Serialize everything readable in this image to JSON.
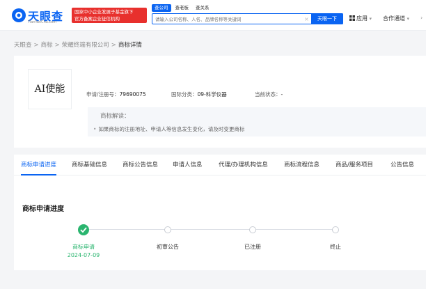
{
  "header": {
    "logo_text": "天眼查",
    "logo_sub": "TianYanCha.com",
    "promo_line1": "国家中小企业发展子基金旗下",
    "promo_line2": "官方备案企业征信机构",
    "search_tabs": [
      "查公司",
      "查老板",
      "查关系"
    ],
    "search_placeholder": "请输入公司名称、人名、品牌名称等关键词",
    "search_clear": "×",
    "search_button": "天眼一下",
    "nav_apps": "应用",
    "nav_coop": "合作通道",
    "nav_more": "›",
    "caret": "▾"
  },
  "breadcrumb": {
    "items": [
      "天眼查",
      "商标",
      "荣耀终端有限公司"
    ],
    "current": "商标详情",
    "separator": ">"
  },
  "trademark": {
    "name": "AI使能",
    "reg_no_label": "申请/注册号：",
    "reg_no": "79690075",
    "class_label": "国际分类：",
    "class_value": "09-科学仪器",
    "status_label": "当前状态：",
    "status_value": "-",
    "interp_title": "商标解读：",
    "interp_bullet": "如果商标的注册地址、申请人等信息发生变化，请及时变更商标",
    "bullet_dot": "•"
  },
  "tabs": [
    "商标申请进度",
    "商标基础信息",
    "商标公告信息",
    "申请人信息",
    "代理/办理机构信息",
    "商标流程信息",
    "商品/服务项目",
    "公告信息"
  ],
  "progress": {
    "title": "商标申请进度",
    "steps": [
      {
        "label": "商标申请",
        "date": "2024-07-09",
        "done": true
      },
      {
        "label": "初审公告",
        "date": "",
        "done": false
      },
      {
        "label": "已注册",
        "date": "",
        "done": false
      },
      {
        "label": "终止",
        "date": "",
        "done": false
      }
    ]
  },
  "colors": {
    "brand": "#0a64f2",
    "promo": "#e8302d",
    "done": "#2ab56f"
  }
}
